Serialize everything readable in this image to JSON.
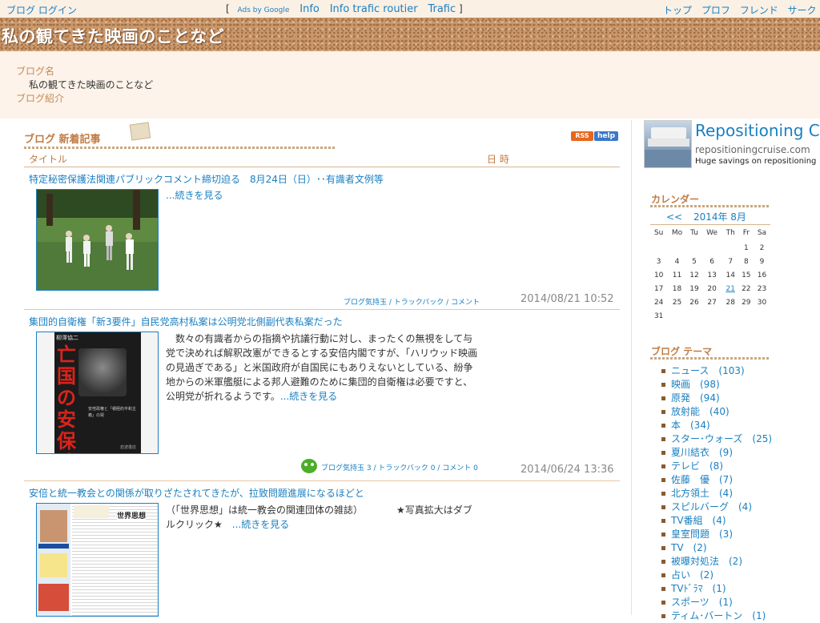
{
  "topbar": {
    "left": "ブログ ログイン",
    "bracket_open": "[",
    "ads": "Ads by Google",
    "links": [
      "Info",
      "Info trafic routier",
      "Trafic"
    ],
    "bracket_close": "]",
    "right": [
      "トップ",
      "プロフ",
      "フレンド",
      "サークル"
    ]
  },
  "blog": {
    "title": "私の観てきた映画のことなど",
    "name_label": "ブログ名",
    "name_value": "私の観てきた映画のことなど",
    "intro_label": "ブログ紹介"
  },
  "section": {
    "title": "ブログ 新着記事",
    "rss": "RSS",
    "help": "help",
    "col_title": "タイトル",
    "col_date": "日 時"
  },
  "entries": [
    {
      "title": "特定秘密保護法関連パブリックコメント締切迫る　8月24日（日）･･有識者文例等",
      "body": "",
      "more": "...続きを見る",
      "meta": "ブログ気持玉 / トラックバック / コメント",
      "date": "2014/08/21 10:52"
    },
    {
      "title": "集団的自衛権「新3要件」自民党高村私案は公明党北側副代表私案だった",
      "body": "　数々の有識者からの指摘や抗議行動に対し、まったくの無視をして与党で決めれば解釈改憲ができるとする安倍内閣ですが、「ハリウッド映画の見過ぎである」と米国政府が自国民にもありえないとしている、紛争地からの米軍艦艇による邦人避難のために集団的自衛権は必要ですと、公明党が折れるようです。",
      "more": "...続きを見る",
      "meta": "ブログ気持玉 3 / トラックバック 0 / コメント 0",
      "date": "2014/06/24 13:36",
      "book_title": "亡国の安保政策",
      "book_author": "柳澤協二",
      "book_sub": "安倍政権と「積極的平和主義」の罠",
      "book_pub": "岩波書店"
    },
    {
      "title": "安倍と統一教会との関係が取りざたされてきたが、拉致問題進展になるほどと",
      "body": "（「世界思想」は統一教会の関連団体の雑誌）　　　　★写真拡大はダブルクリック★　",
      "more": "...続きを見る",
      "mag_title": "世界思想"
    }
  ],
  "ad": {
    "title": "Repositioning C",
    "url": "repositioningcruise.com",
    "desc": "Huge savings on repositioning"
  },
  "calendar": {
    "heading": "カレンダー",
    "prev": "<<",
    "month": "2014年 8月",
    "weekdays": [
      "Su",
      "Mo",
      "Tu",
      "We",
      "Th",
      "Fr",
      "Sa"
    ],
    "weeks": [
      [
        "",
        "",
        "",
        "",
        "",
        "1",
        "2"
      ],
      [
        "3",
        "4",
        "5",
        "6",
        "7",
        "8",
        "9"
      ],
      [
        "10",
        "11",
        "12",
        "13",
        "14",
        "15",
        "16"
      ],
      [
        "17",
        "18",
        "19",
        "20",
        "21",
        "22",
        "23"
      ],
      [
        "24",
        "25",
        "26",
        "27",
        "28",
        "29",
        "30"
      ],
      [
        "31",
        "",
        "",
        "",
        "",
        "",
        ""
      ]
    ],
    "linked_day": "21"
  },
  "themes": {
    "heading": "ブログ テーマ",
    "items": [
      "ニュース　(103)",
      "映画　(98)",
      "原発　(94)",
      "放射能　(40)",
      "本　(34)",
      "スター･ウォーズ　(25)",
      "夏川結衣　(9)",
      "テレビ　(8)",
      "佐藤　優　(7)",
      "北方領土　(4)",
      "スピルバーグ　(4)",
      "TV番組　(4)",
      "皇室問題　(3)",
      "TV　(2)",
      "被曝対処法　(2)",
      "占い　(2)",
      "TVﾄﾞﾗﾏ　(1)",
      "スポーツ　(1)",
      "ティム･バートン　(1)"
    ]
  }
}
